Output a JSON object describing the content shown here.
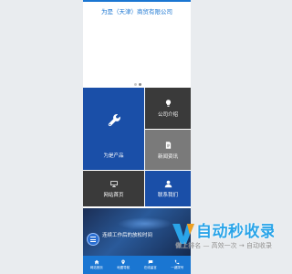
{
  "header": {
    "company_name": "为是（天津）商贸有限公司"
  },
  "banner": {
    "slides": 2,
    "active_slide": 1
  },
  "tiles": {
    "product": "为是产品",
    "about": "公司介绍",
    "news": "新闻资讯",
    "home": "网站首页",
    "contact": "联系我们"
  },
  "scene": {
    "caption": "连续工作后的放松时间"
  },
  "footer": {
    "home": "网站首页",
    "map": "地图导航",
    "online": "在线留言",
    "call": "一键拨号"
  },
  "watermark": {
    "title": "自动秒收录",
    "subtitle": "做上排名 — 高效一次 → 自动收录",
    "colors": {
      "brand": "#2aa4e8"
    }
  },
  "colors": {
    "accent": "#1a76d2",
    "tile_blue": "#1a4fa8",
    "tile_dark": "#3a3a3a",
    "tile_gray": "#7a7a7a"
  },
  "icons": [
    "wrench-icon",
    "lightbulb-icon",
    "document-icon",
    "monitor-icon",
    "person-icon",
    "home-icon",
    "map-pin-icon",
    "chat-icon",
    "phone-icon",
    "menu-icon"
  ]
}
